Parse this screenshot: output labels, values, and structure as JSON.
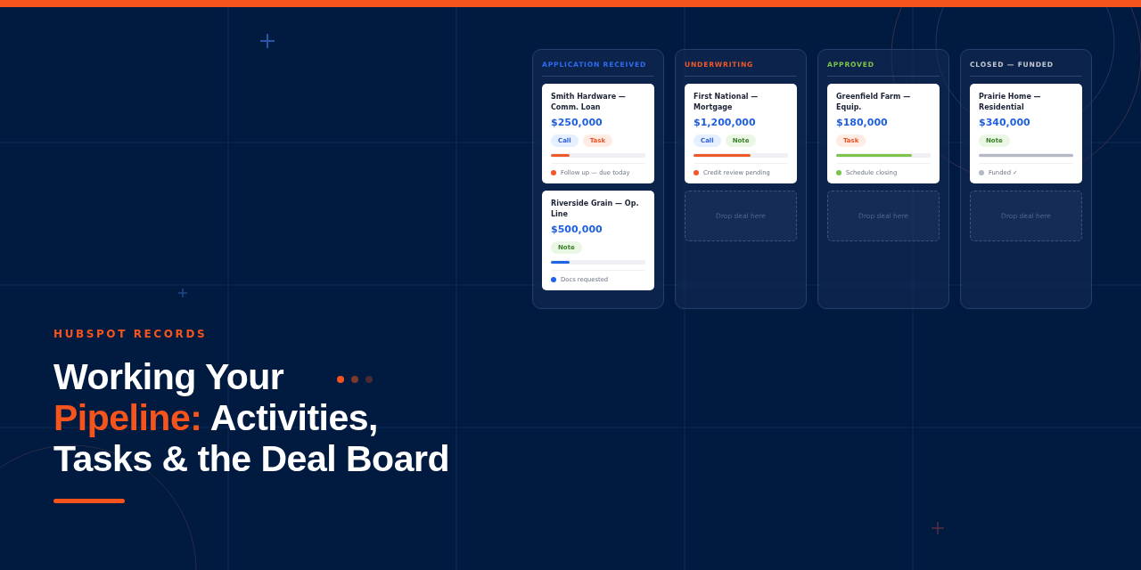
{
  "eyebrow": "HUBSPOT RECORDS",
  "title_lines": [
    {
      "segments": [
        {
          "text": "Working Your",
          "accent": false
        }
      ]
    },
    {
      "segments": [
        {
          "text": "Pipeline:",
          "accent": true
        },
        {
          "text": " Activities,",
          "accent": false
        }
      ]
    },
    {
      "segments": [
        {
          "text": "Tasks & the Deal Board",
          "accent": false
        }
      ]
    }
  ],
  "columns": [
    {
      "title": "APPLICATION RECEIVED",
      "color": "#2f6bf0",
      "cards": [
        {
          "name": "Smith Hardware — Comm. Loan",
          "amount": "$250,000",
          "tags": [
            {
              "label": "Call",
              "kind": "call"
            },
            {
              "label": "Task",
              "kind": "task"
            }
          ],
          "level": 0.2,
          "color": "#f05a28",
          "status": "Follow up — due today"
        },
        {
          "name": "Riverside Grain — Op. Line",
          "amount": "$500,000",
          "tags": [
            {
              "label": "Note",
              "kind": "note"
            }
          ],
          "level": 0.2,
          "color": "#1f63e6",
          "status": "Docs requested"
        }
      ]
    },
    {
      "title": "UNDERWRITING",
      "color": "#f05a28",
      "cards": [
        {
          "name": "First National — Mortgage",
          "amount": "$1,200,000",
          "tags": [
            {
              "label": "Call",
              "kind": "call"
            },
            {
              "label": "Note",
              "kind": "note"
            }
          ],
          "level": 0.6,
          "color": "#f05a28",
          "status": "Credit review pending"
        }
      ],
      "drop_zone": "Drop deal here"
    },
    {
      "title": "APPROVED",
      "color": "#7cc44a",
      "cards": [
        {
          "name": "Greenfield Farm — Equip.",
          "amount": "$180,000",
          "tags": [
            {
              "label": "Task",
              "kind": "task"
            }
          ],
          "level": 0.8,
          "color": "#7cc44a",
          "status": "Schedule closing"
        }
      ],
      "drop_zone": "Drop deal here"
    },
    {
      "title": "CLOSED — FUNDED",
      "color": "#c3c8d2",
      "cards": [
        {
          "name": "Prairie Home — Residential",
          "amount": "$340,000",
          "tags": [
            {
              "label": "Note",
              "kind": "note"
            }
          ],
          "level": 1.0,
          "color": "#b4bac5",
          "status": "Funded ✓"
        }
      ],
      "drop_zone": "Drop deal here"
    }
  ]
}
